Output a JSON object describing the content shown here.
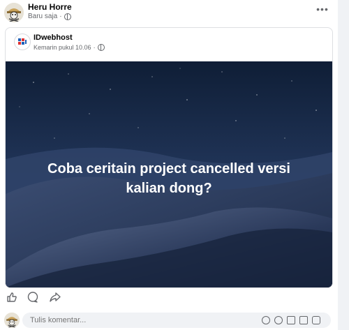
{
  "post": {
    "author": "Heru Horre",
    "time": "Baru saja",
    "separator": "·",
    "more_label": "•••"
  },
  "shared": {
    "page_name": "IDwebhost",
    "time": "Kemarin pukul 10.06",
    "separator": "·",
    "banner_text": "Coba ceritain project cancelled versi kalian dong?"
  },
  "comment": {
    "placeholder": "Tulis komentar..."
  },
  "icons": {
    "like": "like-icon",
    "comment": "comment-icon",
    "share": "share-icon"
  }
}
